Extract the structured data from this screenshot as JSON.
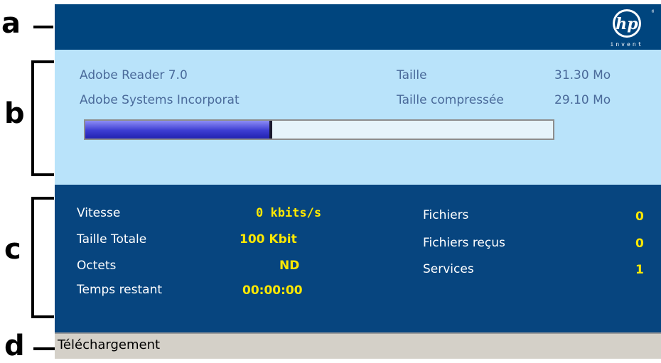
{
  "callouts": {
    "a": "a",
    "b": "b",
    "c": "c",
    "d": "d"
  },
  "header": {
    "logo_text": "hp",
    "tagline": "invent"
  },
  "app": {
    "name": "Adobe Reader 7.0",
    "publisher": "Adobe Systems Incorporat",
    "size_label": "Taille",
    "size_value": "31.30 Mo",
    "compressed_label": "Taille compressée",
    "compressed_value": "29.10 Mo"
  },
  "progress": {
    "fraction": 0.4
  },
  "stats": {
    "speed_label": "Vitesse",
    "speed_value": "0 kbits/s",
    "total_label": "Taille Totale",
    "total_value": "100 Kbit",
    "bytes_label": "Octets",
    "bytes_value": "ND",
    "remaining_label": "Temps restant",
    "remaining_value": "00:00:00",
    "files_label": "Fichiers",
    "files_value": "0",
    "received_label": "Fichiers reçus",
    "received_value": "0",
    "services_label": "Services",
    "services_value": "1"
  },
  "status": {
    "text": "Téléchargement"
  },
  "colors": {
    "header_bg": "#00457e",
    "info_bg": "#b9e3fa",
    "stats_bg": "#07457f",
    "value_yellow": "#ffe800",
    "progress_blue": "#3d3dd2",
    "status_bg": "#d4d0c8"
  }
}
